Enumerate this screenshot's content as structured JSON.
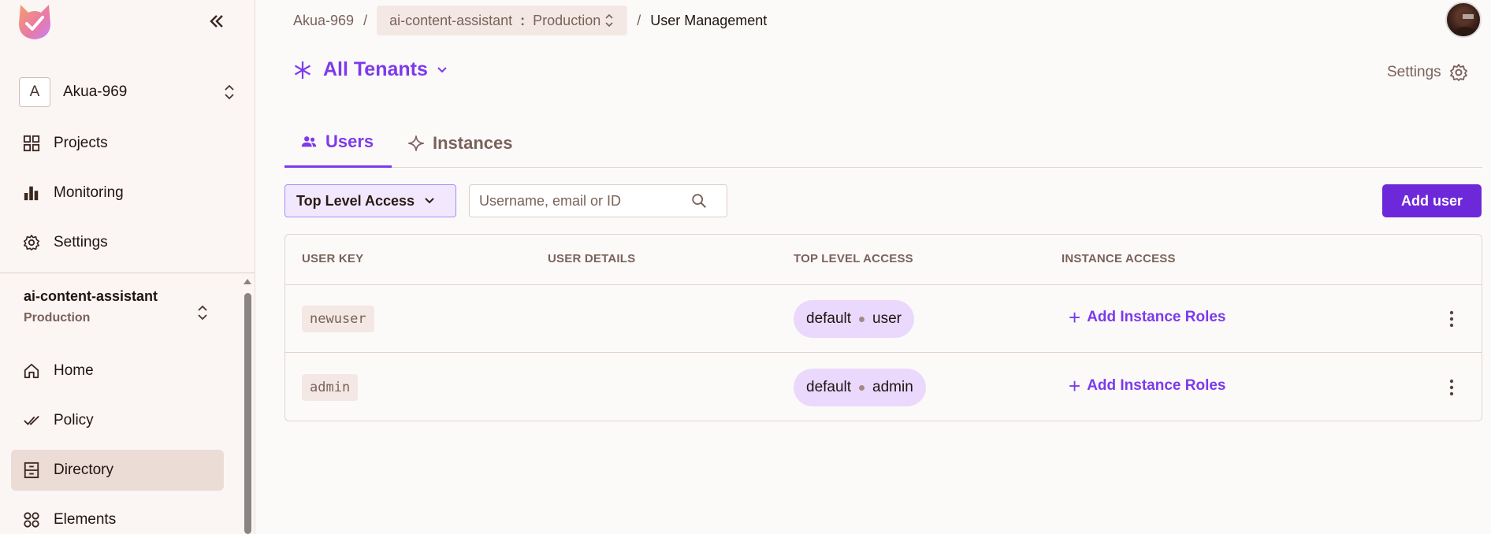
{
  "sidebar": {
    "org": {
      "initial": "A",
      "name": "Akua-969"
    },
    "top_items": [
      {
        "label": "Projects",
        "icon": "grid-icon"
      },
      {
        "label": "Monitoring",
        "icon": "bar-chart-icon"
      },
      {
        "label": "Settings",
        "icon": "gear-icon"
      }
    ],
    "project": {
      "name": "ai-content-assistant",
      "env": "Production"
    },
    "project_items": [
      {
        "label": "Home",
        "icon": "home-icon"
      },
      {
        "label": "Policy",
        "icon": "double-check-icon"
      },
      {
        "label": "Directory",
        "icon": "directory-icon",
        "active": true
      },
      {
        "label": "Elements",
        "icon": "elements-icon"
      }
    ]
  },
  "breadcrumb": {
    "org": "Akua-969",
    "sep": "/",
    "project": "ai-content-assistant",
    "env_sep": ":",
    "env": "Production",
    "current": "User Management"
  },
  "tenant_selector": {
    "label": "All Tenants"
  },
  "settings": {
    "label": "Settings"
  },
  "tabs": [
    {
      "label": "Users",
      "active": true
    },
    {
      "label": "Instances"
    }
  ],
  "toolbar": {
    "filter_label": "Top Level Access",
    "search_placeholder": "Username, email or ID",
    "add_user_label": "Add user"
  },
  "table": {
    "headers": [
      "USER KEY",
      "USER DETAILS",
      "TOP LEVEL ACCESS",
      "INSTANCE ACCESS"
    ],
    "rows": [
      {
        "key": "newuser",
        "details": "",
        "tenant": "default",
        "role": "user",
        "instance_action": "Add Instance Roles"
      },
      {
        "key": "admin",
        "details": "",
        "tenant": "default",
        "role": "admin",
        "instance_action": "Add Instance Roles"
      }
    ]
  },
  "colors": {
    "accent": "#7c3aed",
    "button": "#6d28d9",
    "sidebar_bg": "#fbf6f4",
    "active_item": "#ecdcd6",
    "role_pill": "#ead9fc"
  }
}
